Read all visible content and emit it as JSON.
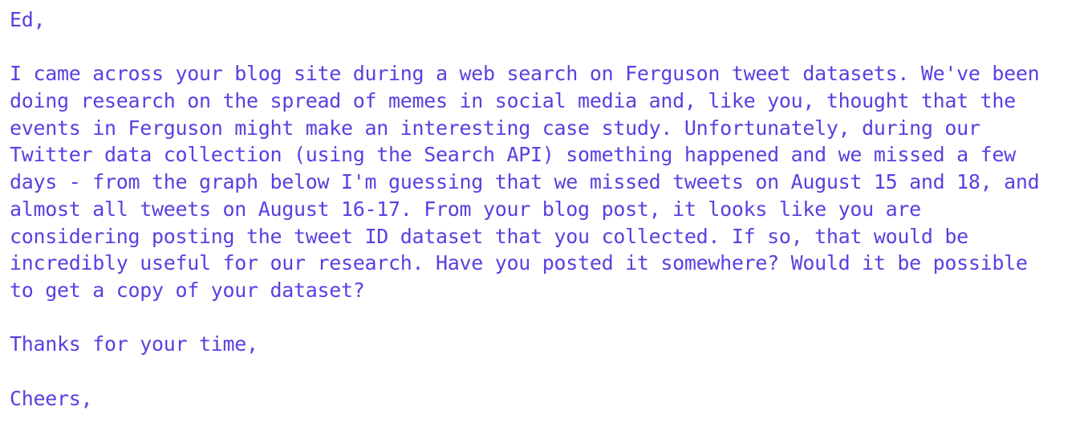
{
  "email": {
    "greeting": "Ed,",
    "body_lines": [
      "I came across your blog site during a web search on Ferguson tweet datasets. We've been",
      "doing research on the spread of memes in social media and, like you, thought that the",
      "events in Ferguson might make an interesting case study. Unfortunately, during our",
      "Twitter data collection (using the Search API) something happened and we missed a few",
      "days - from the graph below I'm guessing that we missed tweets on August 15 and 18, and",
      "almost all tweets on August 16-17. From your blog post, it looks like you are",
      "considering posting the tweet ID dataset that you collected. If so, that would be",
      "incredibly useful for our research. Have you posted it somewhere? Would it be possible",
      "to get a copy of your dataset?"
    ],
    "thanks": "Thanks for your time,",
    "signoff": "Cheers,"
  },
  "colors": {
    "text": "#5a3fe0",
    "background": "#ffffff"
  }
}
